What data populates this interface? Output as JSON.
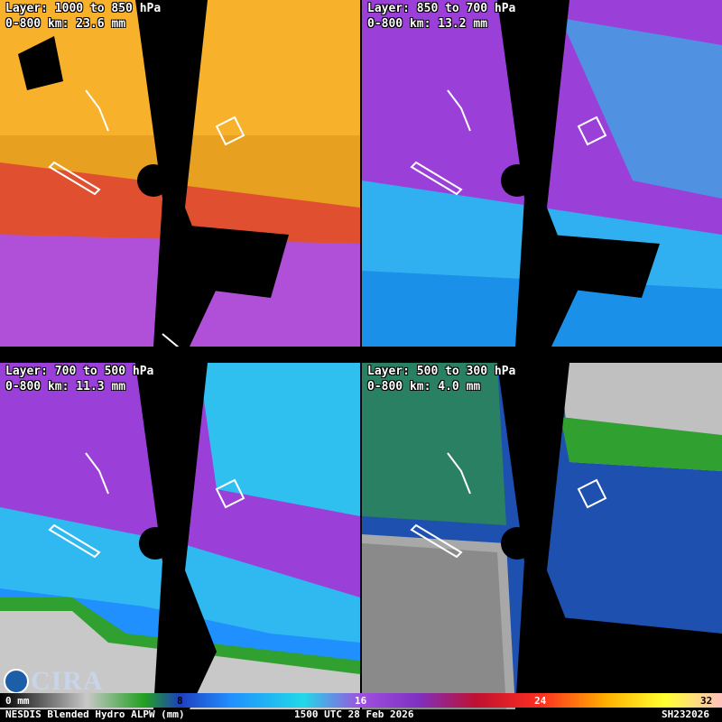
{
  "panels": [
    {
      "layer": "Layer: 1000 to 850 hPa",
      "value": "0-800 km: 23.6 mm",
      "colors": [
        "#ffb020",
        "#ff8020",
        "#e8a030",
        "#c050d0",
        "#e04040"
      ]
    },
    {
      "layer": "Layer: 850 to 700 hPa",
      "value": "0-800 km: 13.2 mm",
      "colors": [
        "#9a40d8",
        "#7a30c0",
        "#30b8f0",
        "#20d0e8",
        "#1a90e8"
      ]
    },
    {
      "layer": "Layer: 700 to 500 hPa",
      "value": "0-800 km: 11.3 mm",
      "colors": [
        "#9a40d8",
        "#30c0f0",
        "#2090ff",
        "#c8c8c8",
        "#30a030"
      ]
    },
    {
      "layer": "Layer: 500 to 300 hPa",
      "value": "0-800 km: 4.0 mm",
      "colors": [
        "#2050b0",
        "#30a030",
        "#1e3fc0",
        "#b0b0b0",
        "#50b850"
      ]
    }
  ],
  "colorbar": {
    "ticks": [
      {
        "label": "0 mm",
        "pos": "0"
      },
      {
        "label": "8",
        "pos": "8"
      },
      {
        "label": "16",
        "pos": "16"
      },
      {
        "label": "24",
        "pos": "24"
      },
      {
        "label": "32",
        "pos": "32"
      }
    ]
  },
  "footer": {
    "product": "NESDIS Blended Hydro ALPW (mm)",
    "time": "1500 UTC 28 Feb 2026",
    "id": "SH232026"
  },
  "logo": {
    "text": "CIRA",
    "noaa": "NOAA"
  }
}
